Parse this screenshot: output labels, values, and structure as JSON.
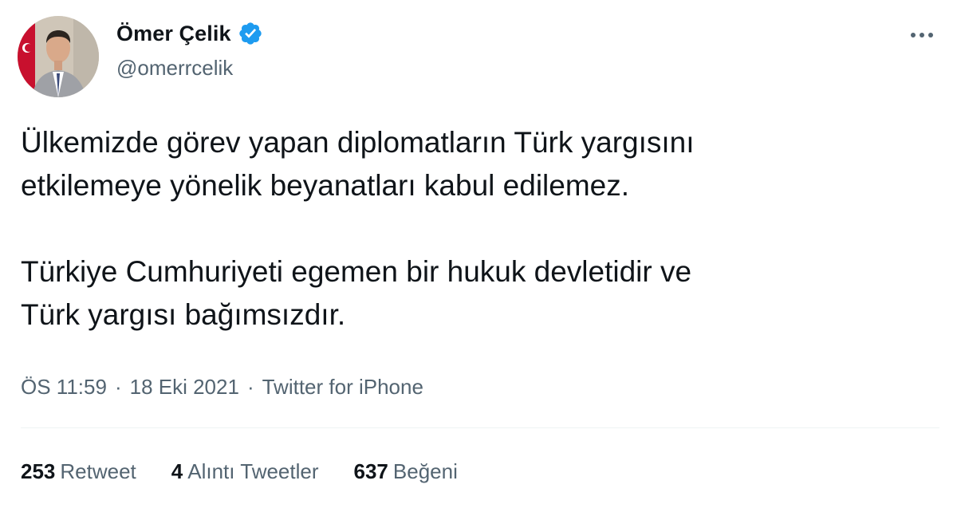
{
  "author": {
    "display_name": "Ömer Çelik",
    "handle": "@omerrcelik",
    "verified_color": "#1d9bf0"
  },
  "tweet": {
    "paragraphs": [
      "Ülkemizde görev yapan diplomatların Türk yargısını\netkilemeye yönelik beyanatları kabul edilemez.",
      "Türkiye Cumhuriyeti egemen bir hukuk devletidir ve\nTürk yargısı bağımsızdır."
    ]
  },
  "meta": {
    "time": "ÖS 11:59",
    "separator": "·",
    "date": "18 Eki 2021",
    "source": "Twitter for iPhone"
  },
  "stats": {
    "retweets": {
      "count": "253",
      "label": "Retweet"
    },
    "quotes": {
      "count": "4",
      "label": "Alıntı Tweetler"
    },
    "likes": {
      "count": "637",
      "label": "Beğeni"
    }
  },
  "colors": {
    "text": "#0f1419",
    "secondary": "#536471",
    "divider": "#eff3f4"
  },
  "icons": {
    "verified": "verified-badge-icon",
    "more": "more-horizontal-icon"
  }
}
